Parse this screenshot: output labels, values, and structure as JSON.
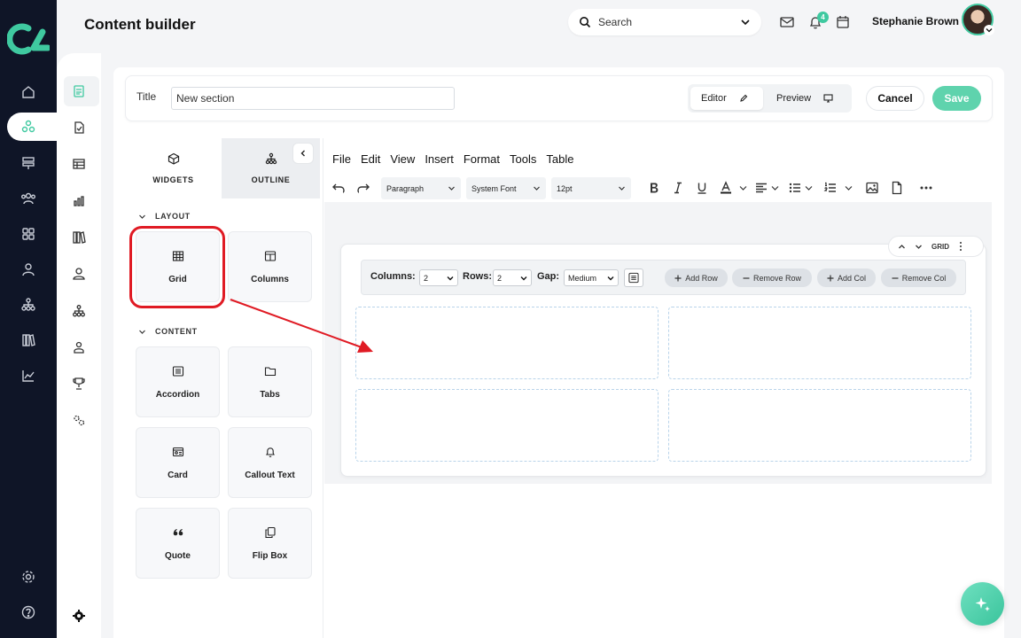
{
  "header": {
    "title": "Content builder",
    "search_placeholder": "Search",
    "notification_count": "4",
    "user_name": "Stephanie Brown"
  },
  "form": {
    "title_label": "Title",
    "title_value": "New section",
    "mode_editor": "Editor",
    "mode_preview": "Preview",
    "cancel": "Cancel",
    "save": "Save"
  },
  "panel": {
    "tab_widgets": "WIDGETS",
    "tab_outline": "OUTLINE",
    "section_layout": "LAYOUT",
    "section_content": "CONTENT",
    "layout_widgets": [
      "Grid",
      "Columns"
    ],
    "content_widgets": [
      "Accordion",
      "Tabs",
      "Card",
      "Callout Text",
      "Quote",
      "Flip Box"
    ]
  },
  "editor": {
    "menu": [
      "File",
      "Edit",
      "View",
      "Insert",
      "Format",
      "Tools",
      "Table"
    ],
    "block_format": "Paragraph",
    "font_family": "System Font",
    "font_size": "12pt"
  },
  "grid": {
    "label": "GRID",
    "columns_label": "Columns:",
    "columns_value": "2",
    "rows_label": "Rows:",
    "rows_value": "2",
    "gap_label": "Gap:",
    "gap_value": "Medium",
    "add_row": "Add Row",
    "remove_row": "Remove Row",
    "add_col": "Add Col",
    "remove_col": "Remove Col"
  },
  "colors": {
    "rail": "#0f1527",
    "accent": "#3fc9a0",
    "highlight": "#e01b24"
  }
}
